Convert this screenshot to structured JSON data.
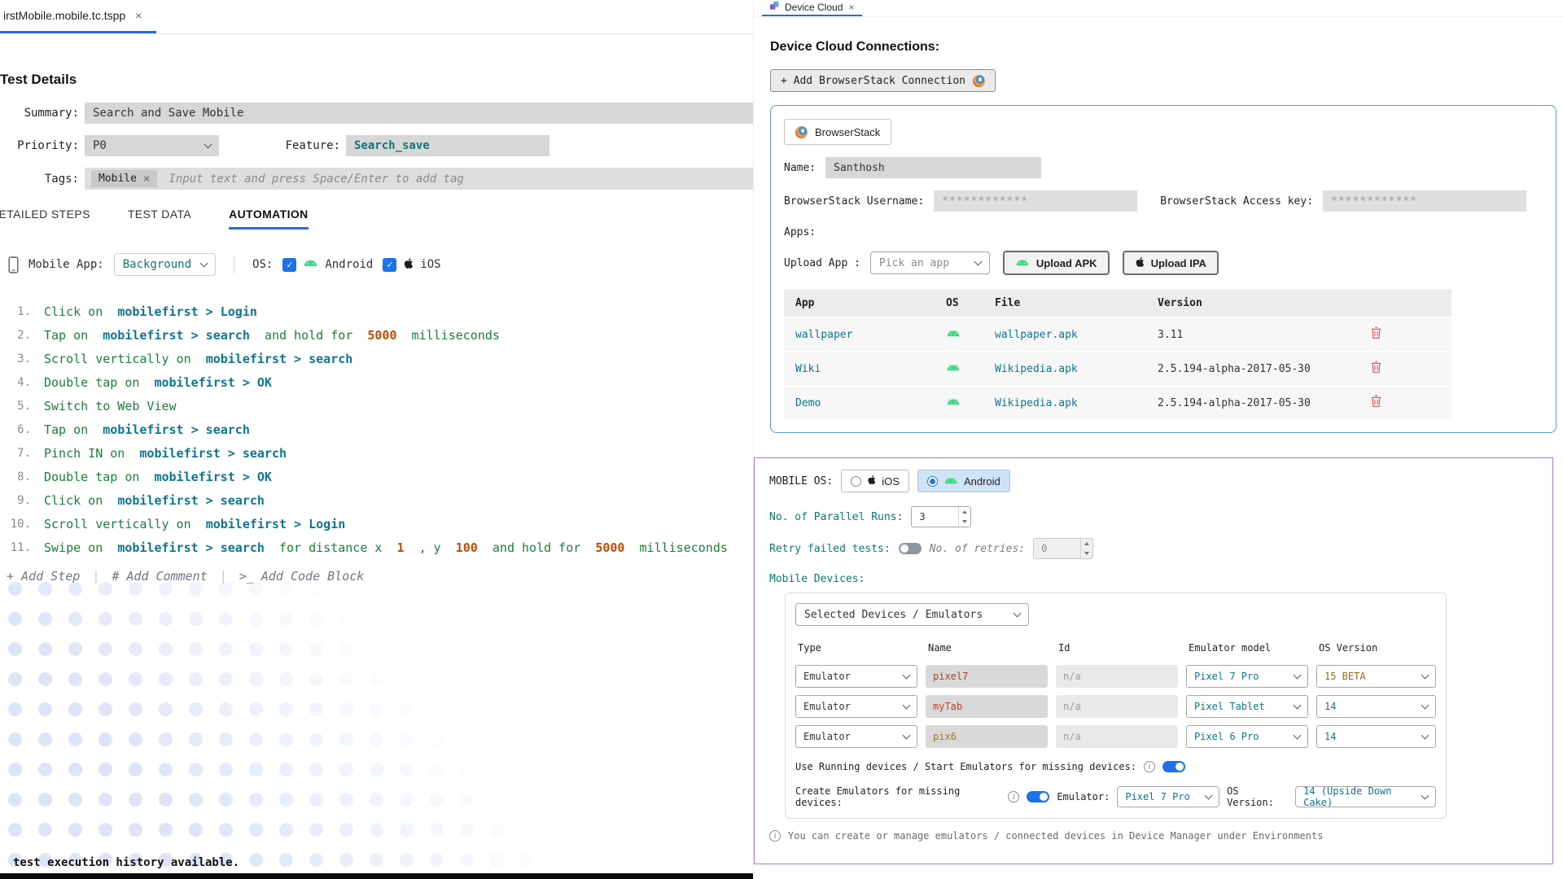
{
  "colors": {
    "accent_blue": "#2b6cd4",
    "toggle_blue": "#1a73e8",
    "blue_card_border": "#5b9bd5",
    "purple_card_border": "#a87cc0",
    "step_action_green": "#1a7f37",
    "element_teal": "#0e7490",
    "number_orange": "#bc4c00",
    "android_green": "#3ddc84",
    "delete_red": "#e05563"
  },
  "left_panel": {
    "tab": {
      "title": "irstMobile.mobile.tc.tspp"
    },
    "details": {
      "heading": "Test Details",
      "summary_label": "Summary:",
      "summary_value": "Search and Save Mobile",
      "priority_label": "Priority:",
      "priority_value": "P0",
      "feature_label": "Feature:",
      "feature_value": "Search_save",
      "tags_label": "Tags:",
      "tag_value": "Mobile",
      "tags_placeholder": "Input text and press Space/Enter to add tag"
    },
    "nav_tabs": [
      {
        "label": "DETAILED STEPS",
        "active": false
      },
      {
        "label": "TEST DATA",
        "active": false
      },
      {
        "label": "AUTOMATION",
        "active": true
      }
    ],
    "toolbar": {
      "mobile_app_label": "Mobile App:",
      "mobile_app_value": "Background",
      "os_label": "OS:",
      "os_android": "Android",
      "os_ios": "iOS"
    },
    "steps": [
      {
        "num": "1.",
        "parts": [
          [
            "a",
            "Click on  "
          ],
          [
            "e",
            "mobilefirst > Login"
          ]
        ]
      },
      {
        "num": "2.",
        "parts": [
          [
            "a",
            "Tap on  "
          ],
          [
            "e",
            "mobilefirst > search"
          ],
          [
            "a",
            "  and hold for  "
          ],
          [
            "n",
            "5000"
          ],
          [
            "a",
            "  milliseconds"
          ]
        ]
      },
      {
        "num": "3.",
        "parts": [
          [
            "a",
            "Scroll vertically on  "
          ],
          [
            "e",
            "mobilefirst > search"
          ]
        ]
      },
      {
        "num": "4.",
        "parts": [
          [
            "a",
            "Double tap on  "
          ],
          [
            "e",
            "mobilefirst > OK"
          ]
        ]
      },
      {
        "num": "5.",
        "parts": [
          [
            "a",
            "Switch to Web View"
          ]
        ]
      },
      {
        "num": "6.",
        "parts": [
          [
            "a",
            "Tap on  "
          ],
          [
            "e",
            "mobilefirst > search"
          ]
        ]
      },
      {
        "num": "7.",
        "parts": [
          [
            "a",
            "Pinch IN on  "
          ],
          [
            "e",
            "mobilefirst > search"
          ]
        ]
      },
      {
        "num": "8.",
        "parts": [
          [
            "a",
            "Double tap on  "
          ],
          [
            "e",
            "mobilefirst > OK"
          ]
        ]
      },
      {
        "num": "9.",
        "parts": [
          [
            "a",
            "Click on  "
          ],
          [
            "e",
            "mobilefirst > search"
          ]
        ]
      },
      {
        "num": "10.",
        "parts": [
          [
            "a",
            "Scroll vertically on  "
          ],
          [
            "e",
            "mobilefirst > Login"
          ]
        ]
      },
      {
        "num": "11.",
        "parts": [
          [
            "a",
            "Swipe on  "
          ],
          [
            "e",
            "mobilefirst > search"
          ],
          [
            "a",
            "  for distance x  "
          ],
          [
            "n",
            "1"
          ],
          [
            "a",
            "  , y  "
          ],
          [
            "n",
            "100"
          ],
          [
            "a",
            "  and hold for  "
          ],
          [
            "n",
            "5000"
          ],
          [
            "a",
            "  milliseconds"
          ]
        ]
      }
    ],
    "footer_actions": [
      "+ Add Step",
      "# Add Comment",
      ">_ Add Code Block"
    ],
    "status_text": "test execution history available."
  },
  "device_cloud": {
    "tab_title": "Device Cloud",
    "heading": "Device Cloud Connections:",
    "add_button": "+ Add BrowserStack Connection",
    "provider": "BrowserStack",
    "name_label": "Name:",
    "name_value": "Santhosh",
    "username_label": "BrowserStack Username:",
    "username_value": "************",
    "access_key_label": "BrowserStack Access key:",
    "access_key_value": "************",
    "apps_label": "Apps:",
    "upload_label": "Upload App :",
    "pick_app_placeholder": "Pick an app",
    "upload_apk": "Upload APK",
    "upload_ipa": "Upload IPA",
    "apps_table": {
      "headers": [
        "App",
        "OS",
        "File",
        "Version"
      ],
      "rows": [
        {
          "app": "wallpaper",
          "os": "android",
          "file": "wallpaper.apk",
          "version": "3.11"
        },
        {
          "app": "Wiki",
          "os": "android",
          "file": "Wikipedia.apk",
          "version": "2.5.194-alpha-2017-05-30"
        },
        {
          "app": "Demo",
          "os": "android",
          "file": "Wikipedia.apk",
          "version": "2.5.194-alpha-2017-05-30"
        }
      ]
    }
  },
  "mobile_os_panel": {
    "os_label": "MOBILE OS:",
    "ios_option": "iOS",
    "android_option": "Android",
    "parallel_label": "No. of Parallel Runs:",
    "parallel_value": "3",
    "retry_label": "Retry failed tests:",
    "retries_label": "No. of retries:",
    "retries_value": "0",
    "devices_label": "Mobile Devices:",
    "devices_dropdown": "Selected Devices / Emulators",
    "devices_table": {
      "headers": [
        "Type",
        "Name",
        "Id",
        "Emulator model",
        "OS Version"
      ],
      "rows": [
        {
          "type": "Emulator",
          "name": "pixel7",
          "name_color": "#a0452e",
          "id": "n/a",
          "model": "Pixel 7 Pro",
          "os_version": "15 BETA",
          "os_color": "#8a6d1a"
        },
        {
          "type": "Emulator",
          "name": "myTab",
          "name_color": "#c43c3c",
          "id": "n/a",
          "model": "Pixel Tablet",
          "os_version": "14",
          "os_color": "#0e7490"
        },
        {
          "type": "Emulator",
          "name": "pix6",
          "name_color": "#9a7b2d",
          "id": "n/a",
          "model": "Pixel 6 Pro",
          "os_version": "14",
          "os_color": "#0e7490"
        }
      ]
    },
    "use_running_label": "Use Running devices / Start Emulators for missing devices:",
    "create_emulators_label": "Create Emulators for missing devices:",
    "emulator_label": "Emulator:",
    "emulator_value": "Pixel 7 Pro",
    "os_version_label": "OS Version:",
    "os_version_value": "14 (Upside Down Cake)",
    "info_text": "You can create or manage emulators / connected devices in Device Manager under Environments"
  }
}
